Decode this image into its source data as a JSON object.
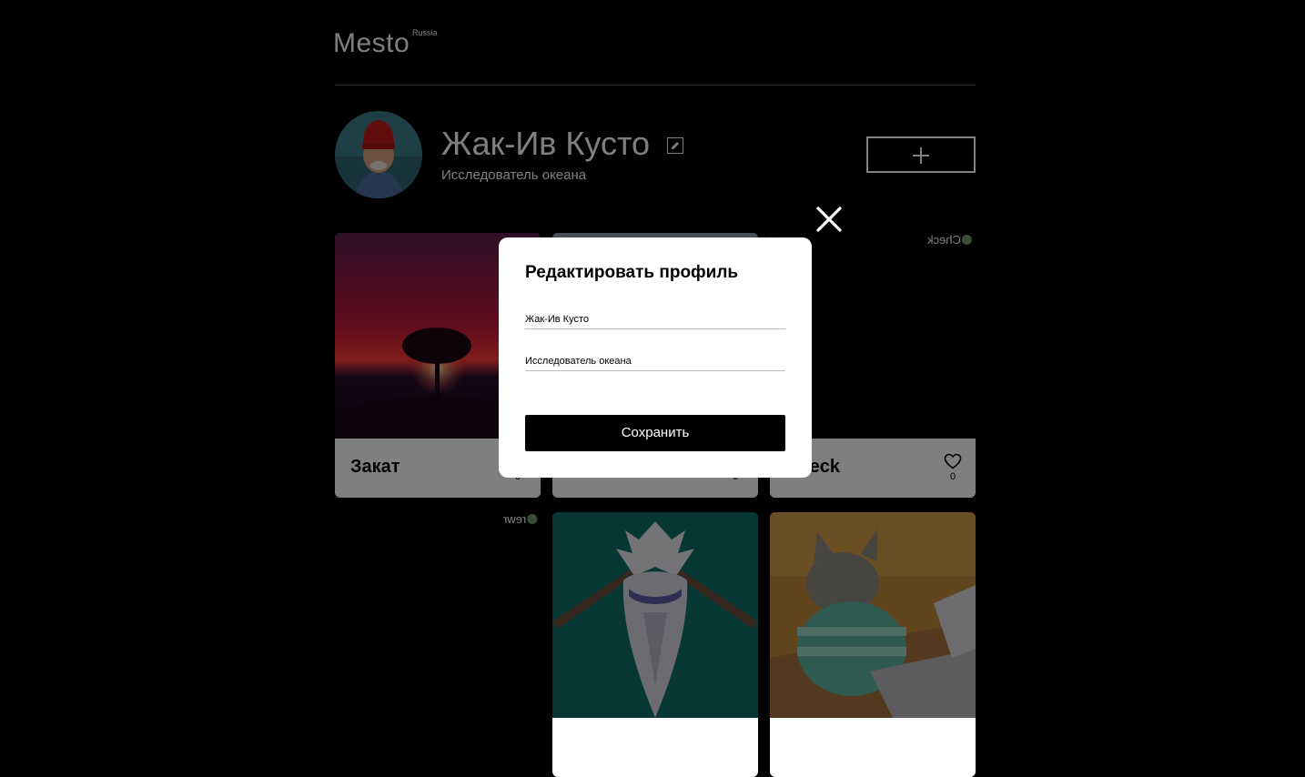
{
  "header": {
    "logo_text": "Mesto",
    "logo_sup": "Russia"
  },
  "profile": {
    "name": "Жак-Ив Кусто",
    "about": "Исследователь океана",
    "edit_icon": "pencil-icon",
    "add_icon": "plus-icon"
  },
  "cards": [
    {
      "title": "Закат",
      "likes": "0",
      "image": "sunset-tree"
    },
    {
      "title": "",
      "likes": "0",
      "image": "photo"
    },
    {
      "title": "Check",
      "likes": "0",
      "image": "broken",
      "alt": "Check"
    },
    {
      "title": "",
      "likes": "",
      "image": "broken",
      "alt": "rewr"
    },
    {
      "title": "",
      "likes": "",
      "image": "feathered-bird"
    },
    {
      "title": "",
      "likes": "",
      "image": "cat-laptop"
    }
  ],
  "popup": {
    "title": "Редактировать профиль",
    "name_value": "Жак-Ив Кусто",
    "about_value": "Исследователь океана",
    "save_label": "Сохранить",
    "close_icon": "close-icon"
  },
  "colors": {
    "background": "#000000",
    "overlay": "rgba(0,0,0,0.5)",
    "popup_bg": "#ffffff",
    "button_bg": "#000000"
  }
}
